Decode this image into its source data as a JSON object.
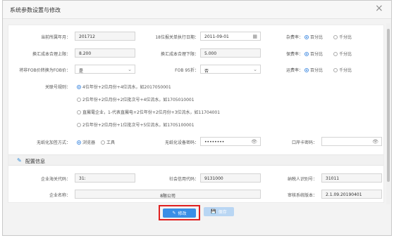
{
  "dialog": {
    "title": "系统参数设置与修改",
    "close_glyph": "×"
  },
  "row1": {
    "period_label": "当前所属年月：",
    "period_value": "201712",
    "exec_date_label": "18位报关单执行日期：",
    "exec_date_value": "2011-09-01",
    "misc_fee_label": "杂费率：",
    "opt_percent": "百分比",
    "opt_permille": "千分比"
  },
  "row2": {
    "fx_upper_label": "换汇成本合理上限：",
    "fx_upper_value": "8.200",
    "fx_lower_label": "换汇成本合理下限：",
    "fx_lower_value": "5.000",
    "insurance_label": "保费率：",
    "opt_percent": "百分比",
    "opt_permille": "千分比"
  },
  "row3": {
    "fob_convert_label": "将非FOB价转换为FOB价：",
    "fob_convert_value": "是",
    "fob95_label": "FOB 95折：",
    "fob95_value": "否",
    "freight_label": "运费率：",
    "opt_percent": "百分比",
    "opt_permille": "千分比"
  },
  "rules": {
    "label": "关联号规则：",
    "options": [
      "4位年份+2位月份+4位流水，如2017050001",
      "2位年份+2位月份+2位批次号+4位流水，如1705010001",
      "直屬電企业，1-代表直屬电+2位年份+2位月份+3位流水，如11704001",
      "2位年份+2位月份+1位批次号+5位流水，如1705100001"
    ]
  },
  "encryption": {
    "label": "无纸化加签方式：",
    "opt_browser": "浏览器",
    "opt_tool": "工具",
    "device_pwd_label": "无纸化设备密码：",
    "device_pwd_value": "••••••••",
    "port_pwd_label": "口岸卡密码：",
    "eye_glyph": "👁"
  },
  "config": {
    "section_title": "配置信息",
    "section_icon": "✎",
    "customs_code_label": "企业海关代码：",
    "customs_code_value": "31:",
    "credit_code_label": "社会信用代码：",
    "credit_code_value": "9131000",
    "taxpayer_label": "纳税人识别号：",
    "taxpayer_value": "31011",
    "company_label": "企业名称：",
    "company_value": "8限公司",
    "version_label": "审核系统版本：",
    "version_value": "2.1.09.20190401"
  },
  "footer": {
    "edit_label": "修改",
    "save_label": "保存",
    "edit_icon": "✎",
    "save_icon": "💾"
  },
  "colors": {
    "accent": "#3a8ee6",
    "highlight": "#e02020"
  }
}
